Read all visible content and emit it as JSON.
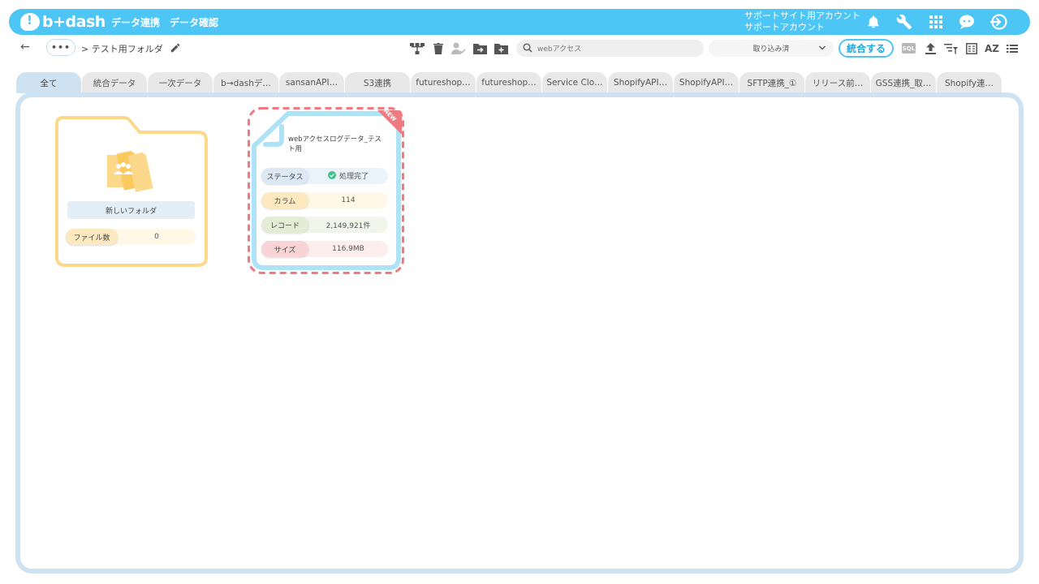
{
  "header": {
    "logo_text": "b+dash",
    "nav": [
      "データ連携",
      "データ確認"
    ],
    "account_line1": "サポートサイト用アカウント",
    "account_line2": "サポートアカウント"
  },
  "toolbar": {
    "breadcrumb": "> テスト用フォルダ",
    "search_value": "webアクセス",
    "select_value": "取り込み済",
    "merge_label": "統合する",
    "sql_label": "SQL",
    "sort_label": "AZ"
  },
  "tabs": [
    "全て",
    "統合データ",
    "一次データ",
    "b→dashデ…",
    "sansanAPI…",
    "S3連携",
    "futureshop…",
    "futureshop…",
    "Service Clo…",
    "ShopifyAPI…",
    "ShopifyAPI…",
    "SFTP連携_①",
    "リリース前…",
    "GSS連携_取…",
    "Shopify連…"
  ],
  "folder": {
    "name": "新しいフォルダ",
    "file_count_label": "ファイル数",
    "file_count_value": "0"
  },
  "datacard": {
    "title": "webアクセスログデータ_テスト用",
    "badge": "NEW",
    "rows": [
      {
        "label": "ステータス",
        "value": "処理完了"
      },
      {
        "label": "カラム",
        "value": "114"
      },
      {
        "label": "レコード",
        "value": "2,149,921件"
      },
      {
        "label": "サイズ",
        "value": "116.9MB"
      }
    ]
  },
  "colors": {
    "brand": "#4dc6f5",
    "folder": "#fcd98a",
    "card": "#aee3f7",
    "highlight": "#ee7a82"
  }
}
